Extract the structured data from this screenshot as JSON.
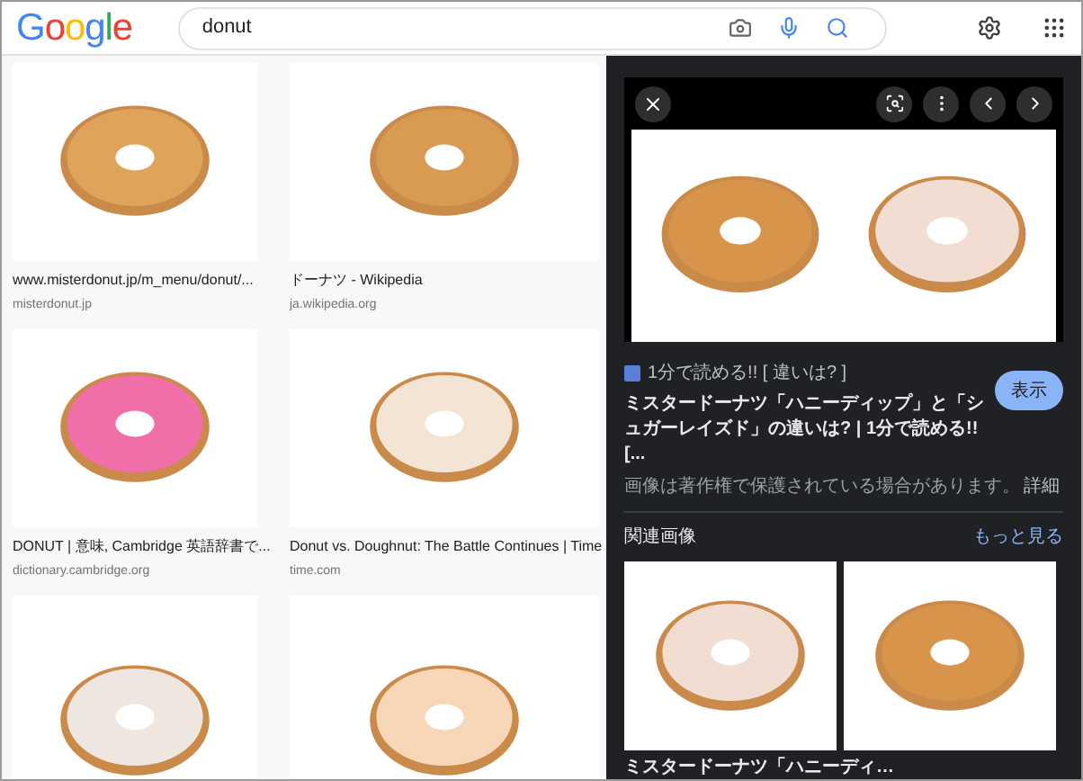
{
  "header": {
    "logo": "Google",
    "search": {
      "value": "donut"
    }
  },
  "results": [
    {
      "kind": "captioned",
      "title": "www.misterdonut.jp/m_menu/donut/...",
      "source": "misterdonut.jp"
    },
    {
      "kind": "captioned",
      "title": "ドーナツ - Wikipedia",
      "source": "ja.wikipedia.org"
    },
    {
      "kind": "captioned",
      "title": "DONUT | 意味, Cambridge 英語辞書で...",
      "source": "dictionary.cambridge.org"
    },
    {
      "kind": "captioned",
      "title": "Donut vs. Doughnut: The Battle Continues | Time",
      "source": "time.com"
    },
    {
      "kind": "image"
    },
    {
      "kind": "image"
    }
  ],
  "preview": {
    "source": "1分で読める!! [ 違いは? ]",
    "title": "ミスタードーナツ「ハニーディップ」と「シュガーレイズド」の違いは? | 1分で読める!! [...",
    "visit_button": "表示",
    "notice": "画像は著作権で保護されている場合があります。",
    "notice_link": "詳細",
    "related": {
      "heading": "関連画像",
      "more_link": "もっと見る",
      "items": [
        {
          "caption": "ミスタードーナツ「ハニーディ…"
        }
      ]
    }
  }
}
